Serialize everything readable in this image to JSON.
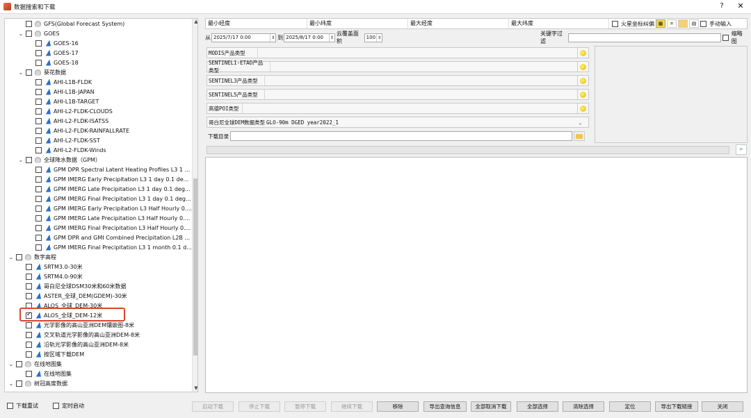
{
  "window": {
    "title": "数据搜索和下载",
    "help": "?",
    "close": "✕"
  },
  "tree": {
    "items": [
      {
        "label": "GFS(Global Forecast System)",
        "level": 1,
        "expander": "",
        "icon": "folder",
        "checked": false
      },
      {
        "label": "GOES",
        "level": 1,
        "expander": "⌄",
        "icon": "folder",
        "checked": false
      },
      {
        "label": "GOES-16",
        "level": 2,
        "expander": "",
        "icon": "layer",
        "checked": false
      },
      {
        "label": "GOES-17",
        "level": 2,
        "expander": "",
        "icon": "layer",
        "checked": false
      },
      {
        "label": "GOES-18",
        "level": 2,
        "expander": "",
        "icon": "layer",
        "checked": false
      },
      {
        "label": "葵花数据",
        "level": 1,
        "expander": "⌄",
        "icon": "folder",
        "checked": false
      },
      {
        "label": "AHI-L1B-FLDK",
        "level": 2,
        "expander": "",
        "icon": "layer",
        "checked": false
      },
      {
        "label": "AHI-L1B-JAPAN",
        "level": 2,
        "expander": "",
        "icon": "layer",
        "checked": false
      },
      {
        "label": "AHI-L1B-TARGET",
        "level": 2,
        "expander": "",
        "icon": "layer",
        "checked": false
      },
      {
        "label": "AHI-L2-FLDK-CLOUDS",
        "level": 2,
        "expander": "",
        "icon": "layer",
        "checked": false
      },
      {
        "label": "AHI-L2-FLDK-ISATSS",
        "level": 2,
        "expander": "",
        "icon": "layer",
        "checked": false
      },
      {
        "label": "AHI-L2-FLDK-RAINFALLRATE",
        "level": 2,
        "expander": "",
        "icon": "layer",
        "checked": false
      },
      {
        "label": "AHI-L2-FLDK-SST",
        "level": 2,
        "expander": "",
        "icon": "layer",
        "checked": false
      },
      {
        "label": "AHI-L2-FLDK-Winds",
        "level": 2,
        "expander": "",
        "icon": "layer",
        "checked": false
      },
      {
        "label": "全球降水数据（GPM）",
        "level": 1,
        "expander": "⌄",
        "icon": "folder",
        "checked": false
      },
      {
        "label": "GPM DPR Spectral Latent Heating Profiles L3 1 ...",
        "level": 2,
        "expander": "",
        "icon": "layer",
        "checked": false
      },
      {
        "label": "GPM IMERG Early Precipitation L3 1 day 0.1 de...",
        "level": 2,
        "expander": "",
        "icon": "layer",
        "checked": false
      },
      {
        "label": "GPM IMERG Late Precipitation L3 1 day 0.1 deg...",
        "level": 2,
        "expander": "",
        "icon": "layer",
        "checked": false
      },
      {
        "label": "GPM IMERG Final Precipitation L3 1 day 0.1 deg...",
        "level": 2,
        "expander": "",
        "icon": "layer",
        "checked": false
      },
      {
        "label": "GPM IMERG Early Precipitation L3 Half Hourly 0....",
        "level": 2,
        "expander": "",
        "icon": "layer",
        "checked": false
      },
      {
        "label": "GPM IMERG Late Precipitation L3 Half Hourly 0....",
        "level": 2,
        "expander": "",
        "icon": "layer",
        "checked": false
      },
      {
        "label": "GPM IMERG Final Precipitation L3 Half Hourly 0....",
        "level": 2,
        "expander": "",
        "icon": "layer",
        "checked": false
      },
      {
        "label": "GPM DPR and GMI Combined Precipitation L2B ...",
        "level": 2,
        "expander": "",
        "icon": "layer",
        "checked": false
      },
      {
        "label": "GPM IMERG Final Precipitation L3 1 month 0.1 d...",
        "level": 2,
        "expander": "",
        "icon": "layer",
        "checked": false
      },
      {
        "label": "数字高程",
        "level": 0,
        "expander": "⌄",
        "icon": "folder",
        "checked": false
      },
      {
        "label": "SRTM3.0-30米",
        "level": 1,
        "expander": "",
        "icon": "layer",
        "checked": false
      },
      {
        "label": "SRTM4.0-90米",
        "level": 1,
        "expander": "",
        "icon": "layer",
        "checked": false
      },
      {
        "label": "哥白尼全球DSM30米和60米数据",
        "level": 1,
        "expander": "",
        "icon": "layer",
        "checked": false
      },
      {
        "label": "ASTER_全球_DEM(GDEM)-30米",
        "level": 1,
        "expander": "",
        "icon": "layer",
        "checked": false
      },
      {
        "label": "ALOS_全球_DEM-30米",
        "level": 1,
        "expander": "",
        "icon": "layer",
        "checked": false
      },
      {
        "label": "ALOS_全球_DEM-12米",
        "level": 1,
        "expander": "",
        "icon": "layer",
        "checked": true
      },
      {
        "label": "光学影像的高山亚洲DEM镶嵌图-8米",
        "level": 1,
        "expander": "",
        "icon": "layer",
        "checked": false
      },
      {
        "label": "交叉轨道光学影像的高山亚洲DEM-8米",
        "level": 1,
        "expander": "",
        "icon": "layer",
        "checked": false
      },
      {
        "label": "沿轨光学影像的高山亚洲DEM-8米",
        "level": 1,
        "expander": "",
        "icon": "layer",
        "checked": false
      },
      {
        "label": "按区域下载DEM",
        "level": 1,
        "expander": "",
        "icon": "layer",
        "checked": false
      },
      {
        "label": "在线地图集",
        "level": 0,
        "expander": "⌄",
        "icon": "folder",
        "checked": false
      },
      {
        "label": "在线地图集",
        "level": 1,
        "expander": "",
        "icon": "layer",
        "checked": false
      },
      {
        "label": "树冠高度数据",
        "level": 0,
        "expander": "⌄",
        "icon": "folder",
        "checked": false
      }
    ]
  },
  "bounds": {
    "min_lon": "最小经度",
    "min_lat": "最小纬度",
    "max_lon": "最大经度",
    "max_lat": "最大纬度",
    "mars_label": "火星坐标纠偏",
    "manual_label": "手动输入"
  },
  "time": {
    "from_label": "从",
    "from": "2025/7/17 0:00",
    "to_label": "到",
    "to": "2025/8/17 0:00",
    "cloud_label": "云覆盖面积",
    "cloud": "100",
    "keyword_label": "关键字过滤",
    "thumb_label": "缩略图"
  },
  "products": [
    {
      "label": "MODIS产品类型",
      "value": ""
    },
    {
      "label": "SENTINEL1-ETAD产品类型",
      "value": ""
    },
    {
      "label": "SENTINEL3产品类型",
      "value": ""
    },
    {
      "label": "SENTINEL5产品类型",
      "value": ""
    },
    {
      "label": "高德POI类型",
      "value": ""
    },
    {
      "label": "哥白尼全球DEM数据类型",
      "value": "GLO-90m DGED year2022_1"
    },
    {
      "label": "下载目录",
      "value": ""
    }
  ],
  "buttons": {
    "start": "启动下载",
    "stop": "停止下载",
    "pause": "暂停下载",
    "resume": "继续下载",
    "remove": "移除",
    "export_query": "导出查询信息",
    "cancel_all": "全部取消下载",
    "select_all": "全部选择",
    "clear": "清除选择",
    "locate": "定位",
    "export_links": "导出下载链接",
    "close": "关闭"
  },
  "options": {
    "retry": "下载重试",
    "timer": "定时启动"
  }
}
